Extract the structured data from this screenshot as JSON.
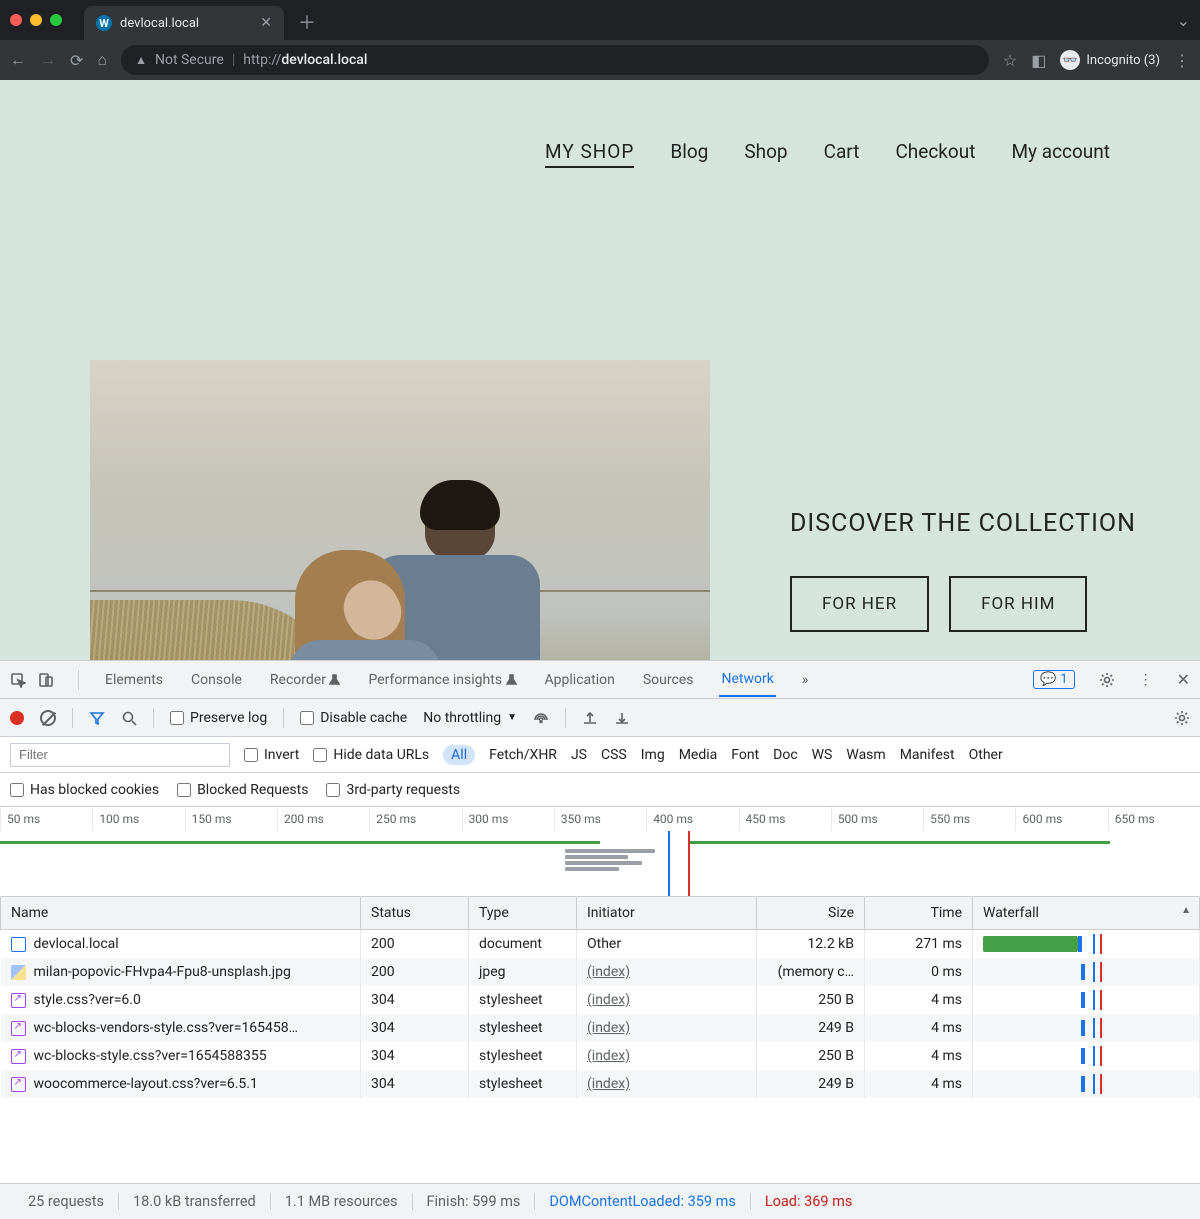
{
  "browser": {
    "tab_title": "devlocal.local",
    "url_prefix": "Not Secure",
    "url_scheme": "http://",
    "url_host": "devlocal.local",
    "incognito_label": "Incognito (3)"
  },
  "page": {
    "nav": {
      "brand": "MY SHOP",
      "items": [
        "Blog",
        "Shop",
        "Cart",
        "Checkout",
        "My account"
      ]
    },
    "hero": {
      "title": "DISCOVER THE COLLECTION",
      "cta_her": "FOR HER",
      "cta_him": "FOR HIM"
    }
  },
  "devtools": {
    "tabs": [
      "Elements",
      "Console",
      "Recorder",
      "Performance insights",
      "Application",
      "Sources",
      "Network"
    ],
    "active_tab": "Network",
    "issues_badge": "1",
    "toolbar": {
      "preserve_log": "Preserve log",
      "disable_cache": "Disable cache",
      "throttling": "No throttling"
    },
    "filter_placeholder": "Filter",
    "filter_row": {
      "invert": "Invert",
      "hide_urls": "Hide data URLs",
      "types": [
        "All",
        "Fetch/XHR",
        "JS",
        "CSS",
        "Img",
        "Media",
        "Font",
        "Doc",
        "WS",
        "Wasm",
        "Manifest",
        "Other"
      ]
    },
    "filter_row2": {
      "blocked_cookies": "Has blocked cookies",
      "blocked_requests": "Blocked Requests",
      "third_party": "3rd-party requests"
    },
    "timeline_ticks": [
      "50 ms",
      "100 ms",
      "150 ms",
      "200 ms",
      "250 ms",
      "300 ms",
      "350 ms",
      "400 ms",
      "450 ms",
      "500 ms",
      "550 ms",
      "600 ms",
      "650 ms"
    ],
    "columns": [
      "Name",
      "Status",
      "Type",
      "Initiator",
      "Size",
      "Time",
      "Waterfall"
    ],
    "rows": [
      {
        "icon": "doc",
        "name": "devlocal.local",
        "status": "200",
        "type": "document",
        "initiator": "Other",
        "init_link": false,
        "size": "12.2 kB",
        "time": "271 ms",
        "wf": "big"
      },
      {
        "icon": "img",
        "name": "milan-popovic-FHvpa4-Fpu8-unsplash.jpg",
        "status": "200",
        "type": "jpeg",
        "initiator": "(index)",
        "init_link": true,
        "size": "(memory c…",
        "time": "0 ms",
        "wf": "edge"
      },
      {
        "icon": "css",
        "name": "style.css?ver=6.0",
        "status": "304",
        "type": "stylesheet",
        "initiator": "(index)",
        "init_link": true,
        "size": "250 B",
        "time": "4 ms",
        "wf": "edge"
      },
      {
        "icon": "css",
        "name": "wc-blocks-vendors-style.css?ver=165458…",
        "status": "304",
        "type": "stylesheet",
        "initiator": "(index)",
        "init_link": true,
        "size": "249 B",
        "time": "4 ms",
        "wf": "edge"
      },
      {
        "icon": "css",
        "name": "wc-blocks-style.css?ver=1654588355",
        "status": "304",
        "type": "stylesheet",
        "initiator": "(index)",
        "init_link": true,
        "size": "250 B",
        "time": "4 ms",
        "wf": "edge"
      },
      {
        "icon": "css",
        "name": "woocommerce-layout.css?ver=6.5.1",
        "status": "304",
        "type": "stylesheet",
        "initiator": "(index)",
        "init_link": true,
        "size": "249 B",
        "time": "4 ms",
        "wf": "edge"
      }
    ],
    "status": {
      "requests": "25 requests",
      "transferred": "18.0 kB transferred",
      "resources": "1.1 MB resources",
      "finish": "Finish: 599 ms",
      "dcl": "DOMContentLoaded: 359 ms",
      "load": "Load: 369 ms"
    }
  }
}
